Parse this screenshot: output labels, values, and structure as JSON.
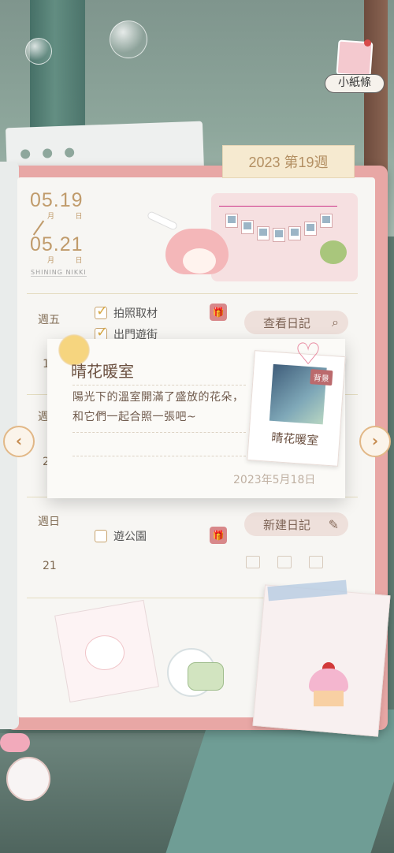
{
  "header": {
    "week_label": "2023 第19週",
    "sticky_note_label": "小紙條"
  },
  "date_range": {
    "start": "05.19",
    "end": "05.21",
    "month_day_labels": "月 日",
    "brand": "SHINING NIKKI"
  },
  "days": [
    {
      "day_name": "週五",
      "day_number": "1",
      "tasks": [
        {
          "label": "拍照取材",
          "checked": true
        },
        {
          "label": "出門遊街",
          "checked": true
        }
      ],
      "action_label": "查看日記"
    },
    {
      "day_name": "週",
      "day_number": "2"
    },
    {
      "day_name": "週日",
      "day_number": "21",
      "tasks": [
        {
          "label": "遊公園",
          "checked": false
        }
      ],
      "action_label": "新建日記"
    }
  ],
  "popup": {
    "title": "晴花暖室",
    "description": "陽光下的溫室開滿了盛放的花朵，和它們一起合照一張吧~",
    "date": "2023年5月18日",
    "photo_caption": "晴花暖室",
    "photo_tag": "背景"
  },
  "icons": {
    "prev": "chevron-left-icon",
    "next": "chevron-right-icon",
    "search": "search-icon",
    "edit": "edit-icon",
    "gift": "gift-icon",
    "heart": "heart-icon"
  },
  "colors": {
    "notebook_border": "#e8a7a5",
    "accent_gold": "#c09b6b",
    "button_bg": "#eee0db"
  }
}
